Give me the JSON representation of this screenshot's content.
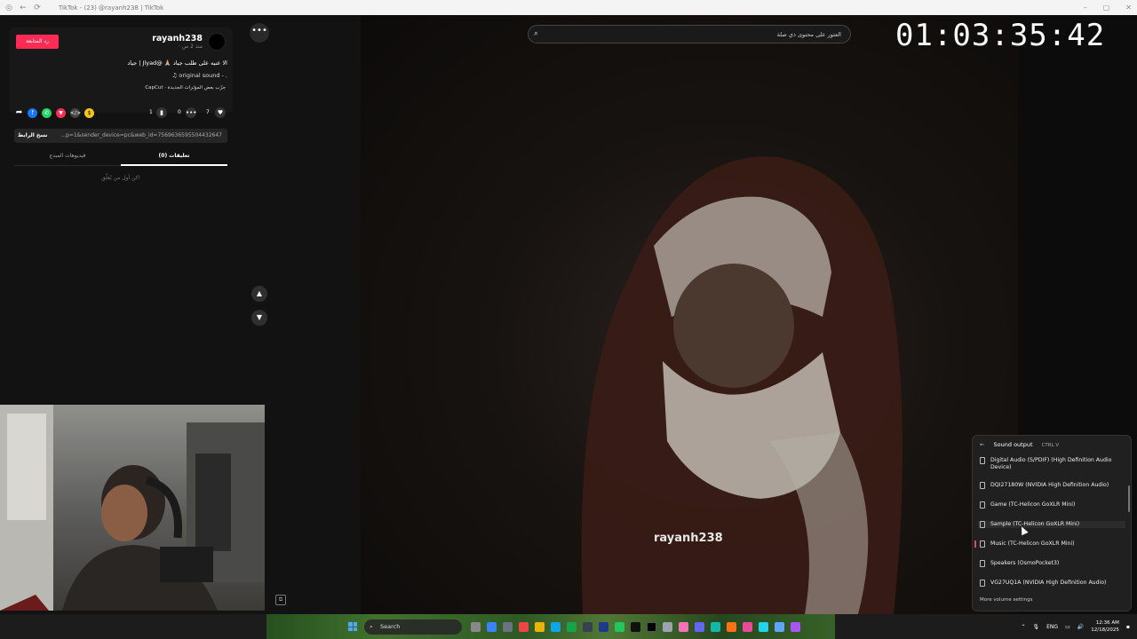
{
  "browser": {
    "tab_title": "TikTok - (23) @rayanh238 | TikTok",
    "window_controls": [
      "–",
      "▢",
      "✕"
    ]
  },
  "post": {
    "username": "rayanh238",
    "posted_ago": "· منذ 2 س",
    "follow_label": "رد المتابعة",
    "caption": "الا عنيه على طلب جياد 🙏🏼 @Jlyad | جياد",
    "sound": "original sound - .",
    "capcut": "CapCut · جرّب بعض المؤثرات الجديدة",
    "stats": {
      "likes": "7",
      "comments": "0",
      "bookmarks": "1"
    },
    "copy_link_label": "نسخ الرابط",
    "share_url": "...p=1&sender_device=pc&web_id=7569636595504432647",
    "tabs": [
      "فيديوهات المبدع",
      "تعليقات (0)"
    ],
    "empty_comments": "كن أول من يُعلّق!"
  },
  "video": {
    "overlay_username": "rayanh238",
    "search_placeholder": "العثور على محتوى ذي صلة"
  },
  "timer": "01:03:35:42",
  "sound_output": {
    "title": "Sound output",
    "shortcut": "CTRL V",
    "devices": [
      "Digital Audio (S/PDIF) (High Definition Audio Device)",
      "DQI27180W (NVIDIA High Definition Audio)",
      "Game (TC-Helicon GoXLR Mini)",
      "Sample (TC-Helicon GoXLR Mini)",
      "Music (TC-Helicon GoXLR Mini)",
      "Speakers (OsmoPocket3)",
      "VG27UQ1A (NVIDIA High Definition Audio)"
    ],
    "selected_index": 4,
    "hover_index": 3,
    "more_label": "More volume settings"
  },
  "taskbar": {
    "search_label": "Search",
    "language": "ENG",
    "time": "12:36 AM",
    "date": "12/18/2025"
  }
}
